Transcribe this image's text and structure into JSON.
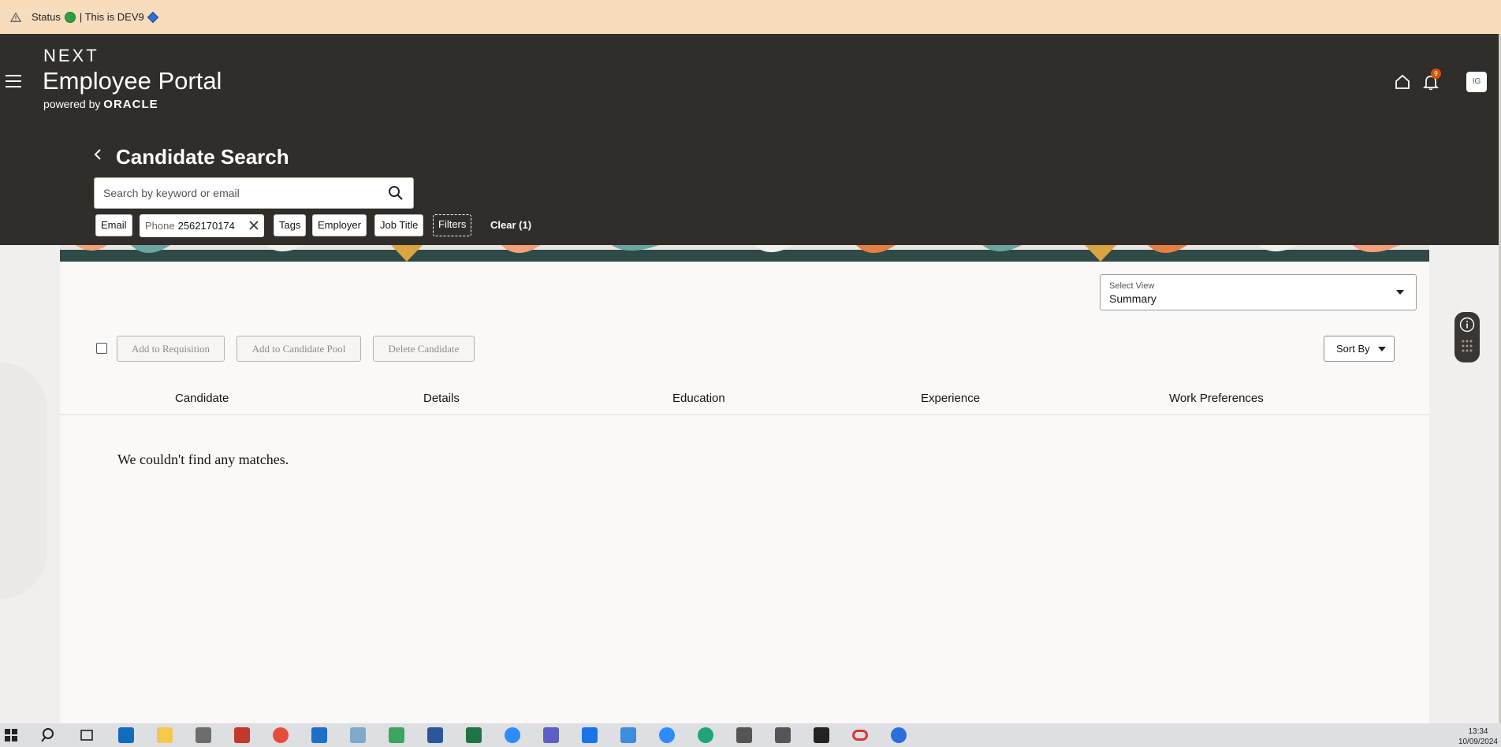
{
  "status_bar": {
    "status_label": "Status",
    "env_text": "| This is DEV9"
  },
  "header": {
    "brand_next": "NEXT",
    "brand_portal": "Employee Portal",
    "powered_prefix": "powered by",
    "powered_brand": "ORACLE",
    "notification_count": "9",
    "avatar_initials": "IG"
  },
  "page": {
    "title": "Candidate Search",
    "search_placeholder": "Search by keyword or email"
  },
  "filters": {
    "email": "Email",
    "phone_label": "Phone",
    "phone_value": "2562170174",
    "tags": "Tags",
    "employer": "Employer",
    "job_title": "Job Title",
    "filters": "Filters",
    "clear": "Clear (1)"
  },
  "toolbar": {
    "select_view_label": "Select View",
    "select_view_value": "Summary",
    "add_to_requisition": "Add to Requisition",
    "add_to_pool": "Add to Candidate Pool",
    "delete_candidate": "Delete Candidate",
    "sort_by": "Sort By"
  },
  "table": {
    "columns": [
      "Candidate",
      "Details",
      "Education",
      "Experience",
      "Work Preferences"
    ],
    "empty_message": "We couldn't find any matches."
  },
  "taskbar": {
    "time": "13:34",
    "date": "10/09/2024"
  }
}
